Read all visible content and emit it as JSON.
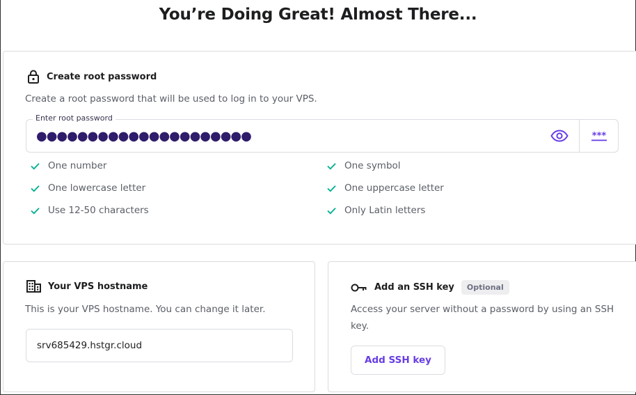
{
  "page": {
    "title": "You’re Doing Great! Almost There..."
  },
  "root_password": {
    "title": "Create root password",
    "description": "Create a root password that will be used to log in to your VPS.",
    "field_label": "Enter root password",
    "field_value": "●●●●●●●●●●●●●●●●●●●●●",
    "icons": {
      "lock": "lock-icon",
      "show": "eye-icon",
      "generate": "generate-password-icon"
    },
    "requirements": [
      {
        "label": "One number",
        "met": true
      },
      {
        "label": "One symbol",
        "met": true
      },
      {
        "label": "One lowercase letter",
        "met": true
      },
      {
        "label": "One uppercase letter",
        "met": true
      },
      {
        "label": "Use 12-50 characters",
        "met": true
      },
      {
        "label": "Only Latin letters",
        "met": true
      }
    ]
  },
  "hostname": {
    "title": "Your VPS hostname",
    "description": "This is your VPS hostname. You can change it later.",
    "value": "srv685429.hstgr.cloud",
    "icon": "building-icon"
  },
  "ssh": {
    "title": "Add an SSH key",
    "badge": "Optional",
    "description": "Access your server without a password by using an SSH key.",
    "button": "Add SSH key",
    "icon": "key-icon"
  },
  "colors": {
    "accent": "#673de6",
    "check": "#00b090",
    "text": "#1d1e20",
    "muted": "#5a5e66",
    "border": "#dadce0"
  }
}
